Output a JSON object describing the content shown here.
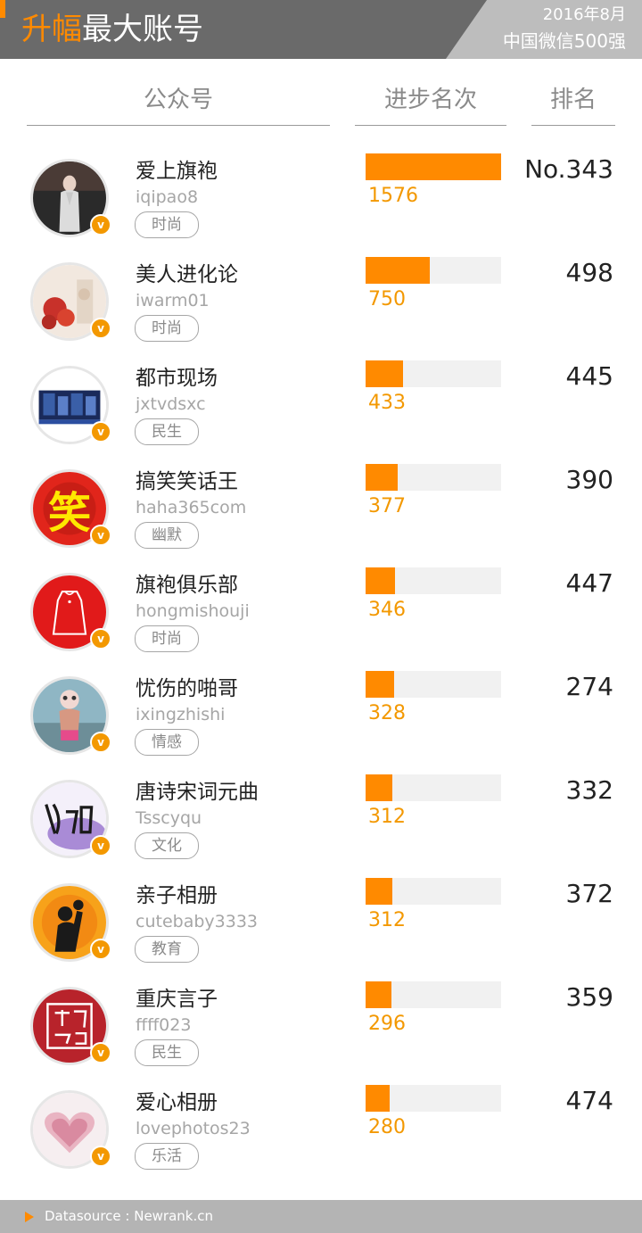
{
  "header": {
    "title_highlight": "升幅",
    "title_rest": "最大账号",
    "date": "2016年8月",
    "subtitle": "中国微信500强"
  },
  "columns": {
    "account": "公众号",
    "progress": "进步名次",
    "rank": "排名"
  },
  "accent_color": "#ff8a00",
  "max_progress": 1576,
  "rows": [
    {
      "name": "爱上旗袍",
      "id": "iqipao8",
      "tag": "时尚",
      "progress": 1576,
      "rank": "No.343",
      "avatar": "woman-in-qipao-photo"
    },
    {
      "name": "美人进化论",
      "id": "iwarm01",
      "tag": "时尚",
      "progress": 750,
      "rank": "498",
      "avatar": "flowers-photo"
    },
    {
      "name": "都市现场",
      "id": "jxtvdsxc",
      "tag": "民生",
      "progress": 433,
      "rank": "445",
      "avatar": "city-logo"
    },
    {
      "name": "搞笑笑话王",
      "id": "haha365com",
      "tag": "幽默",
      "progress": 377,
      "rank": "390",
      "avatar": "smile-character-logo",
      "avatar_glyph": "笑"
    },
    {
      "name": "旗袍俱乐部",
      "id": "hongmishouji",
      "tag": "时尚",
      "progress": 346,
      "rank": "447",
      "avatar": "qipao-outline-logo"
    },
    {
      "name": "忧伤的啪哥",
      "id": "ixingzhishi",
      "tag": "情感",
      "progress": 328,
      "rank": "274",
      "avatar": "cartoon-figure-photo"
    },
    {
      "name": "唐诗宋词元曲",
      "id": "Tsscyqu",
      "tag": "文化",
      "progress": 312,
      "rank": "332",
      "avatar": "calligraphy-logo"
    },
    {
      "name": "亲子相册",
      "id": "cutebaby3333",
      "tag": "教育",
      "progress": 312,
      "rank": "372",
      "avatar": "parent-child-silhouette"
    },
    {
      "name": "重庆言子",
      "id": "ffff023",
      "tag": "民生",
      "progress": 296,
      "rank": "359",
      "avatar": "seal-logo"
    },
    {
      "name": "爱心相册",
      "id": "lovephotos23",
      "tag": "乐活",
      "progress": 280,
      "rank": "474",
      "avatar": "heart-collage-logo"
    }
  ],
  "footer": {
    "source": "Datasource : Newrank.cn"
  }
}
